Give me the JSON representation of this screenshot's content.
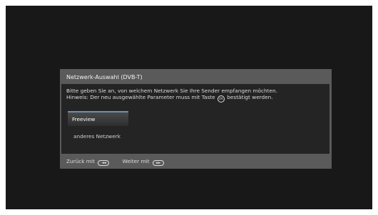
{
  "dialog": {
    "title": "Netzwerk-Auswahl (DVB-T)",
    "message_line1": "Bitte geben Sie an, von welchem Netzwerk Sie Ihre Sender empfangen möchten.",
    "message_line2_before": "Hinweis: Der neu ausgewählte Parameter muss mit Taste",
    "message_line2_after": "bestätigt werden.",
    "ok_key_glyph": "OK"
  },
  "options": [
    {
      "label": "Freeview",
      "selected": true
    },
    {
      "label": "anderes Netzwerk",
      "selected": false
    }
  ],
  "footer": {
    "back_label": "Zurück mit",
    "back_key_glyph": "◄◄",
    "forward_label": "Weiter mit",
    "forward_key_glyph": "►►"
  },
  "colors": {
    "screen_background": "#181818",
    "dialog_frame": "#5a5a5a",
    "dialog_body": "#242424",
    "selection_accent": "#6e8fb8"
  }
}
